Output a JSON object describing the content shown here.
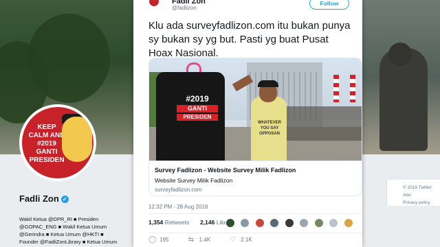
{
  "tweet": {
    "author_name": "Fadli Zon",
    "author_handle": "@fadlizon",
    "follow_label": "Follow",
    "text": "Klu ada surveyfadlizon.com  itu bukan punya sy bukan sy yg but. Pasti yg buat Pusat Hoax Nasional.",
    "timestamp": "12:32 PM - 28 Aug 2018",
    "link_card": {
      "title": "Survey Fadlizon - Website Survey Milik Fadlizon",
      "description": "Website Survey Milik Fadlizon",
      "url": "surveyfadlizon.com"
    },
    "retweets_count": "1,354",
    "retweets_label": "Retweets",
    "likes_count": "2,146",
    "likes_label": "Likes",
    "actions": {
      "replies": "195",
      "retweets": "1.4K",
      "likes": "2.1K"
    },
    "image_text": {
      "shirt_year": "#2019",
      "shirt_ganti": "GANTI",
      "shirt_presiden": "PRESIDEN",
      "man_shirt": "WHATEVER YOU SAY OPPOSAN"
    }
  },
  "profile": {
    "name": "Fadli Zon",
    "avatar_text": "KEEP CALM AND #2019 GANTI PRESIDEN",
    "bio_lines": [
      "Wakil Ketua @DPR_RI  ■  Presiden",
      "@GOPAC_ENG  ■  Wakil Ketua Umum",
      "@Gerindra  ■  Ketua Umum @HKTI  ■",
      "Founder @FadliZonLibrary  ■  Ketua Umum"
    ]
  },
  "sidebar": {
    "copyright": "© 2018 Twitter  Abo",
    "privacy": "Privacy policy"
  },
  "colors": {
    "accent": "#1da1f2",
    "text": "#14171a",
    "muted": "#657786"
  }
}
